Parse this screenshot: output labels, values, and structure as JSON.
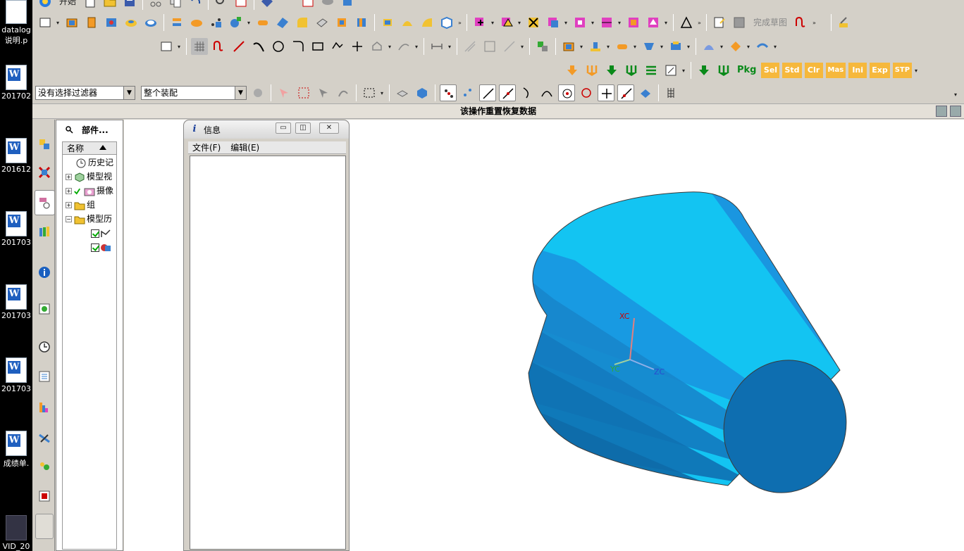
{
  "desktop": {
    "items": [
      {
        "label": "datalog",
        "sublabel": "说明.p",
        "icon": "document-icon"
      },
      {
        "label": "201702",
        "icon": "word-doc-icon"
      },
      {
        "label": "201612",
        "icon": "word-doc-icon"
      },
      {
        "label": "201703",
        "icon": "word-doc-icon"
      },
      {
        "label": "201703",
        "icon": "word-doc-icon"
      },
      {
        "label": "201703",
        "icon": "word-doc-icon"
      },
      {
        "label": "成绩单.",
        "icon": "word-doc-icon"
      },
      {
        "label": "VID_20",
        "icon": "video-file-icon"
      }
    ],
    "word_glyph": "W"
  },
  "toolbar": {
    "start_label": "开始",
    "finish_sketch_label": "完成草图",
    "pkg_buttons": [
      "Pkg",
      "Sel",
      "Std",
      "Clr",
      "Mas",
      "Ini",
      "Exp",
      "STP"
    ]
  },
  "filter_bar": {
    "selection_filter": "没有选择过滤器",
    "scope": "整个装配"
  },
  "status_bar": {
    "message": "该操作重置恢复数据"
  },
  "part_navigator": {
    "title": "部件...",
    "column_name": "名称",
    "nodes": [
      {
        "label": "历史记"
      },
      {
        "label": "模型视"
      },
      {
        "label": "摄像"
      },
      {
        "label": "组"
      },
      {
        "label": "模型历"
      }
    ]
  },
  "info_window": {
    "title": "信息",
    "glyph": "i",
    "menu": [
      "文件(F)",
      "编辑(E)"
    ],
    "buttons": {
      "minimize": "▭",
      "restore": "◫",
      "close": "✕"
    }
  },
  "viewport": {
    "axes": {
      "x": "XC",
      "y": "YC",
      "z": "ZC",
      "corner_x": "X"
    },
    "colors": {
      "light": "#13c4f2",
      "mid": "#1a96e0",
      "dark": "#0e6aa8",
      "end_face": "#0e6eb0",
      "outline": "#3a3a3a"
    }
  }
}
